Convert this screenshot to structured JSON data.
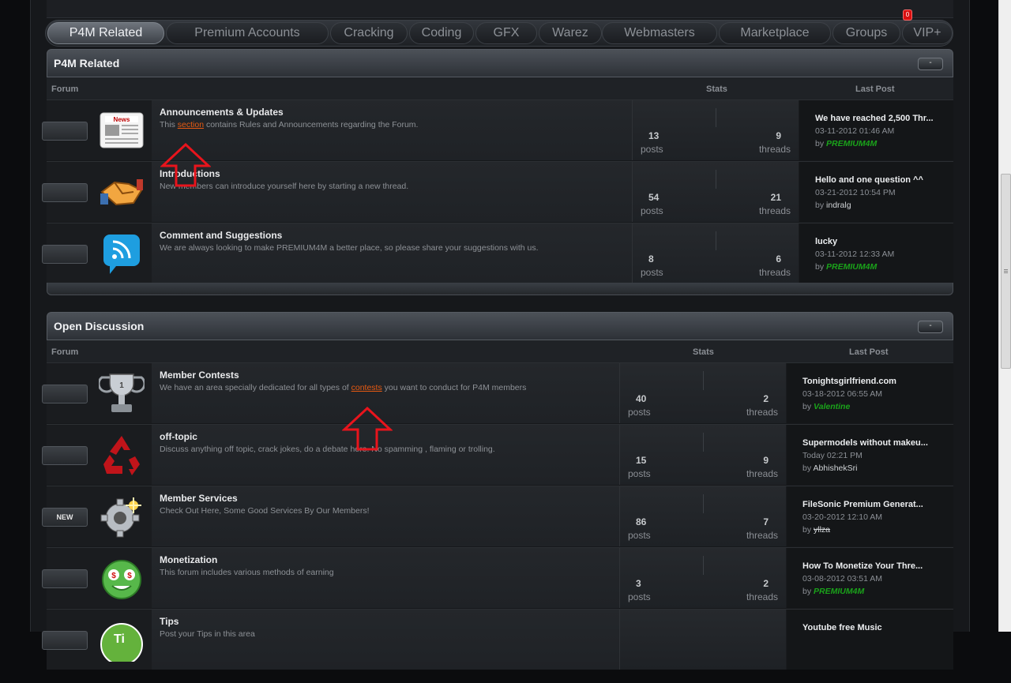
{
  "nav": {
    "tabs": [
      "P4M Related",
      "Premium Accounts",
      "Cracking",
      "Coding",
      "GFX",
      "Warez",
      "Webmasters",
      "Marketplace",
      "Groups",
      "VIP+"
    ],
    "active": "P4M Related",
    "notif_badge": "0"
  },
  "colors": {
    "accent": "#e65a12",
    "username_green": "#1aa31a",
    "arrow_red": "#e8141c"
  },
  "sections": [
    {
      "title": "P4M Related",
      "collapse_label": "-",
      "columns": {
        "forum": "Forum",
        "stats": "Stats",
        "last_post": "Last Post"
      },
      "forums": [
        {
          "icon": "news-icon",
          "icon_text": "News",
          "name": "Announcements & Updates",
          "desc_pre": "This ",
          "desc_hl": "section",
          "desc_post": " contains Rules and Announcements regarding the Forum.",
          "posts": "13",
          "posts_label": "posts",
          "threads": "9",
          "threads_label": "threads",
          "last_title": "We have reached 2,500 Thr...",
          "last_date": "03-11-2012 01:46 AM",
          "last_by": "by",
          "last_user": "PREMIUM4M",
          "user_style": "g"
        },
        {
          "icon": "handshake-icon",
          "name": "Introductions",
          "desc_pre": "New members can introduce yourself here by starting a new thread.",
          "desc_hl": "",
          "desc_post": "",
          "posts": "54",
          "posts_label": "posts",
          "threads": "21",
          "threads_label": "threads",
          "last_title": "Hello and one question ^^",
          "last_date": "03-21-2012 10:54 PM",
          "last_by": "by",
          "last_user": "indralg",
          "user_style": "u"
        },
        {
          "icon": "chat-icon",
          "name": "Comment and Suggestions",
          "desc_pre": "We are always looking to make PREMIUM4M a better place, so please share your suggestions with us.",
          "desc_hl": "",
          "desc_post": "",
          "posts": "8",
          "posts_label": "posts",
          "threads": "6",
          "threads_label": "threads",
          "last_title": "lucky",
          "last_date": "03-11-2012 12:33 AM",
          "last_by": "by",
          "last_user": "PREMIUM4M",
          "user_style": "g"
        }
      ]
    },
    {
      "title": "Open Discussion",
      "collapse_label": "-",
      "columns": {
        "forum": "Forum",
        "stats": "Stats",
        "last_post": "Last Post"
      },
      "forums": [
        {
          "icon": "trophy-icon",
          "name": "Member Contests",
          "desc_pre": "We have an area specially dedicated for all types of ",
          "desc_hl": "contests",
          "desc_post": " you want to conduct for P4M members",
          "posts": "40",
          "posts_label": "posts",
          "threads": "2",
          "threads_label": "threads",
          "last_title": "Tonightsgirlfriend.com",
          "last_date": "03-18-2012 06:55 AM",
          "last_by": "by",
          "last_user": "Valentine",
          "user_style": "g"
        },
        {
          "icon": "recycle-icon",
          "name": "off-topic",
          "desc_pre": "Discuss anything off topic, crack jokes, do a debate here. No spamming , flaming or trolling.",
          "desc_hl": "",
          "desc_post": "",
          "posts": "15",
          "posts_label": "posts",
          "threads": "9",
          "threads_label": "threads",
          "last_title": "Supermodels without makeu...",
          "last_date": "Today 02:21 PM",
          "last_by": "by",
          "last_user": "AbhishekSri",
          "user_style": "u"
        },
        {
          "icon": "gear-icon",
          "status": "NEW",
          "name": "Member Services",
          "desc_pre": "Check Out Here, Some Good Services By Our Members!",
          "desc_hl": "",
          "desc_post": "",
          "posts": "86",
          "posts_label": "posts",
          "threads": "7",
          "threads_label": "threads",
          "last_title": "FileSonic Premium Generat...",
          "last_date": "03-20-2012 12:10 AM",
          "last_by": "by",
          "last_user": "yllza",
          "user_style": "s"
        },
        {
          "icon": "money-face-icon",
          "name": "Monetization",
          "desc_pre": "This forum includes various methods of earning",
          "desc_hl": "",
          "desc_post": "",
          "posts": "3",
          "posts_label": "posts",
          "threads": "2",
          "threads_label": "threads",
          "last_title": "How To Monetize Your Thre...",
          "last_date": "03-08-2012 03:51 AM",
          "last_by": "by",
          "last_user": "PREMIUM4M",
          "user_style": "g"
        },
        {
          "icon": "tips-icon",
          "icon_text": "Ti",
          "name": "Tips",
          "desc_pre": "Post your Tips in this area",
          "desc_hl": "",
          "desc_post": "",
          "posts": "",
          "posts_label": "",
          "threads": "",
          "threads_label": "",
          "last_title": "Youtube free Music",
          "last_date": "",
          "last_by": "",
          "last_user": "",
          "user_style": "u"
        }
      ]
    }
  ]
}
